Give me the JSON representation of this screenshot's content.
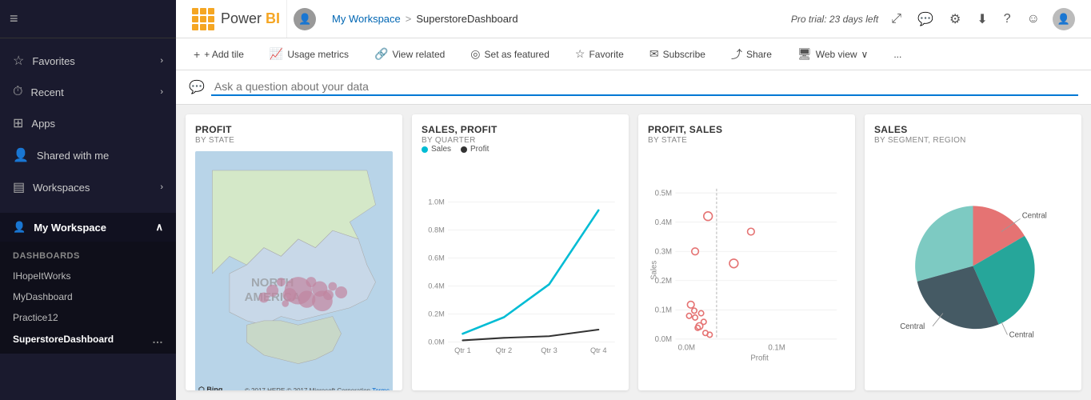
{
  "app": {
    "logo_text": "Power BI",
    "logo_color": "BI"
  },
  "header": {
    "breadcrumb_link": "My Workspace",
    "breadcrumb_sep": ">",
    "breadcrumb_current": "SuperstoreDashboard",
    "pro_trial": "Pro trial: 23 days left"
  },
  "toolbar": {
    "add_tile": "+ Add tile",
    "usage_metrics": "Usage metrics",
    "view_related": "View related",
    "set_featured": "Set as featured",
    "favorite": "Favorite",
    "subscribe": "Subscribe",
    "share": "Share",
    "web_view": "Web view",
    "more": "..."
  },
  "qa": {
    "placeholder": "Ask a question about your data"
  },
  "sidebar": {
    "menu_icon": "≡",
    "nav_items": [
      {
        "id": "favorites",
        "label": "Favorites",
        "icon": "☆",
        "has_chevron": true
      },
      {
        "id": "recent",
        "label": "Recent",
        "icon": "⏱",
        "has_chevron": true
      },
      {
        "id": "apps",
        "label": "Apps",
        "icon": "⊞"
      },
      {
        "id": "shared",
        "label": "Shared with me",
        "icon": "👤"
      },
      {
        "id": "workspaces",
        "label": "Workspaces",
        "icon": "⊟",
        "has_chevron": true
      }
    ],
    "workspace_label": "My Workspace",
    "dashboards_label": "DASHBOARDS",
    "dashboard_items": [
      {
        "id": "ihopeitworks",
        "label": "IHopeItWorks",
        "selected": false
      },
      {
        "id": "mydashboard",
        "label": "MyDashboard",
        "selected": false
      },
      {
        "id": "practice12",
        "label": "Practice12",
        "selected": false
      },
      {
        "id": "superstoredashboard",
        "label": "SuperstoreDashboard",
        "selected": true
      }
    ]
  },
  "charts": [
    {
      "id": "profit-state",
      "title": "Profit",
      "subtitle": "BY STATE",
      "type": "map"
    },
    {
      "id": "sales-profit-quarter",
      "title": "Sales, Profit",
      "subtitle": "BY QUARTER",
      "type": "line",
      "legend": [
        {
          "label": "Sales",
          "color": "#00bcd4"
        },
        {
          "label": "Profit",
          "color": "#333"
        }
      ],
      "y_labels": [
        "1.0M",
        "0.8M",
        "0.6M",
        "0.4M",
        "0.2M",
        "0.0M"
      ],
      "x_labels": [
        "Qtr 1",
        "Qtr 2",
        "Qtr 3",
        "Qtr 4"
      ]
    },
    {
      "id": "profit-sales-state",
      "title": "Profit, Sales",
      "subtitle": "BY STATE",
      "type": "scatter",
      "y_labels": [
        "0.5M",
        "0.4M",
        "0.3M",
        "0.2M",
        "0.1M",
        "0.0M"
      ],
      "x_labels": [
        "0.0M",
        "0.1M"
      ],
      "x_axis_label": "Profit",
      "y_axis_label": "Sales"
    },
    {
      "id": "sales-segment",
      "title": "Sales",
      "subtitle": "BY SEGMENT, REGION",
      "type": "pie",
      "labels": [
        "Central",
        "Central",
        "Central"
      ],
      "colors": [
        "#e57373",
        "#26a69a",
        "#455a64"
      ]
    }
  ],
  "icons": {
    "hamburger": "≡",
    "star": "☆",
    "clock": "🕐",
    "grid": "⊞",
    "person": "👤",
    "layers": "▤",
    "focus": "⤢",
    "comment": "💬",
    "settings": "⚙",
    "download": "⬇",
    "help": "?",
    "smiley": "☺",
    "avatar": "○",
    "add": "+",
    "chart": "📈",
    "link": "🔗",
    "star_filled": "★",
    "mail": "✉",
    "share": "⤴",
    "monitor": "🖥",
    "chevron_right": "›",
    "chevron_down": "∨",
    "ellipsis": "…",
    "dialog": "💬"
  }
}
